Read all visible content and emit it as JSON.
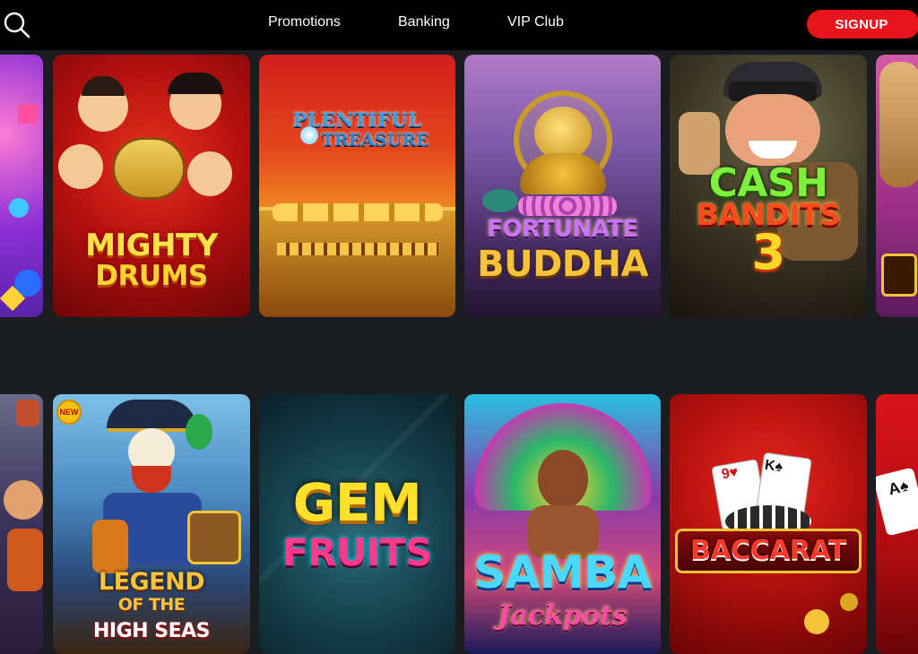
{
  "header": {
    "nav": [
      "Promotions",
      "Banking",
      "VIP Club"
    ],
    "signup_label": "SIGNUP"
  },
  "colors": {
    "header_bg": "#000000",
    "page_bg": "#1b1c1f",
    "signup_bg": "#e8141b"
  },
  "icons": {
    "search": "search-icon"
  },
  "games_row1": [
    {
      "title_line1": "MIGHTY",
      "title_line2": "DRUMS"
    },
    {
      "title_line1": "PLENTIFUL",
      "title_line2": "TREASURE"
    },
    {
      "title_line1": "FORTUNATE",
      "title_line2": "BUDDHA"
    },
    {
      "title_line1": "CASH",
      "title_line2": "BANDITS",
      "title_line3": "3"
    }
  ],
  "games_row2": [
    {
      "badge": "NEW",
      "title_line1": "LEGEND",
      "title_line2": "OF THE",
      "title_line3": "HIGH SEAS"
    },
    {
      "title_line1": "GEM",
      "title_line2": "FRUITS"
    },
    {
      "title_line1": "SAMBA",
      "title_line2": "Jackpots"
    },
    {
      "title_line1": "BACCARAT"
    }
  ]
}
